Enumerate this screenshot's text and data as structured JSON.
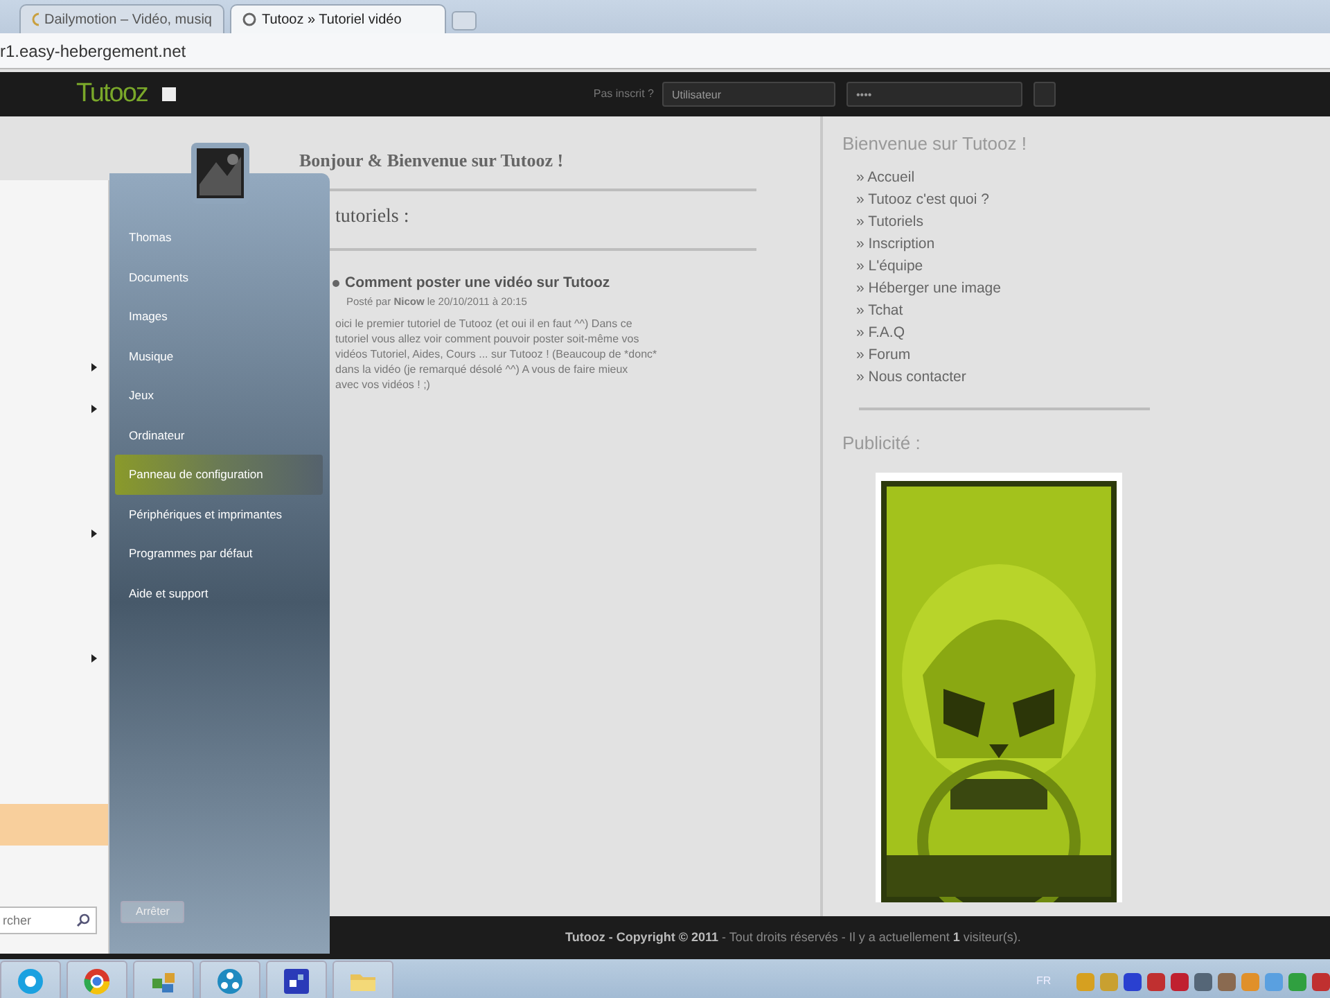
{
  "browser": {
    "tabs": [
      {
        "title": "Dailymotion – Vidéo, musiq",
        "selected": false
      },
      {
        "title": "Tutooz » Tutoriel vidéo",
        "selected": true
      }
    ],
    "address": "r1.easy-hebergement.net"
  },
  "site_header": {
    "logo": "Tutooz",
    "login_prompt": "Pas inscrit ?",
    "username": "Utilisateur",
    "password": "••••"
  },
  "main": {
    "welcome": "Bonjour & Bienvenue sur Tutooz !",
    "section": "tutoriels :",
    "article": {
      "title": "Comment poster une vidéo sur Tutooz",
      "meta": "Posté par **Nicow** le 20/10/2011 à 20:15",
      "lines": [
        "oici le premier tutoriel de Tutooz (et oui il en faut ^^) Dans ce",
        "tutoriel vous allez voir comment pouvoir poster soit-même vos",
        "vidéos Tutoriel, Aides, Cours ... sur Tutooz ! (Beaucoup de *donc*",
        "dans la vidéo (je remarqué désolé ^^) A vous de faire mieux",
        "avec vos vidéos ! ;)"
      ]
    }
  },
  "sidebar": {
    "title": "Bienvenue sur Tutooz !",
    "links": [
      "» Accueil",
      "» Tutooz c'est quoi ?",
      "» Tutoriels",
      "» Inscription",
      "» L'équipe",
      "» Héberger une image",
      "» Tchat",
      "» F.A.Q",
      "» Forum",
      "» Nous contacter"
    ],
    "ad_title": "Publicité :"
  },
  "footer": "**Tutooz - Copyright © 2011** - Tout droits réservés - Il y a actuellement **1** visiteur(s).",
  "start_menu": {
    "left_rows": [
      {
        "kind": "blank"
      },
      {
        "kind": "blank"
      },
      {
        "kind": "blank"
      },
      {
        "kind": "blank"
      },
      {
        "kind": "submenu"
      },
      {
        "kind": "submenu"
      },
      {
        "kind": "blank"
      },
      {
        "kind": "blank"
      },
      {
        "kind": "submenu"
      },
      {
        "kind": "blank"
      },
      {
        "kind": "blank"
      },
      {
        "kind": "submenu"
      },
      {
        "kind": "blank"
      },
      {
        "kind": "blank"
      },
      {
        "kind": "blank"
      },
      {
        "kind": "highlight"
      }
    ],
    "search_placeholder": "rcher",
    "items": [
      {
        "label": "Thomas",
        "selected": false
      },
      {
        "label": "Documents",
        "selected": false
      },
      {
        "label": "Images",
        "selected": false
      },
      {
        "label": "Musique",
        "selected": false
      },
      {
        "label": "Jeux",
        "selected": false
      },
      {
        "label": "Ordinateur",
        "selected": false
      },
      {
        "label": "Panneau de configuration",
        "selected": true
      },
      {
        "label": "Périphériques et imprimantes",
        "selected": false
      },
      {
        "label": "Programmes par défaut",
        "selected": false
      },
      {
        "label": "Aide et support",
        "selected": false
      }
    ],
    "shutdown": "Arrêter"
  },
  "taskbar": {
    "language": "FR"
  }
}
